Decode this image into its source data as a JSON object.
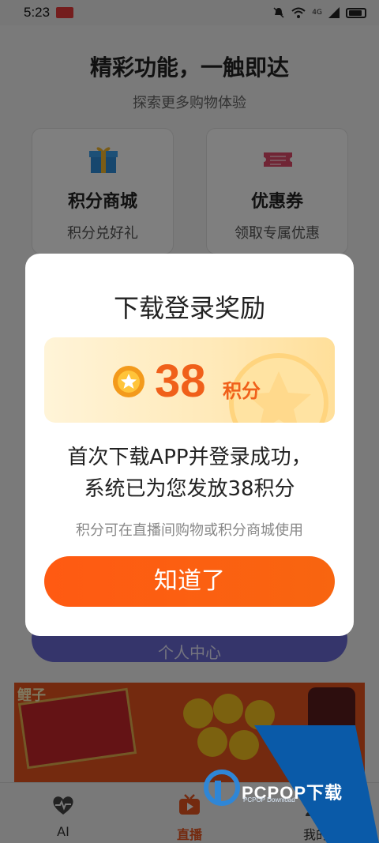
{
  "status_bar": {
    "time": "5:23",
    "signal_text": "4G"
  },
  "page": {
    "feature_title": "精彩功能，一触即达",
    "feature_subtitle": "探索更多购物体验",
    "cards": [
      {
        "title": "积分商城",
        "desc": "积分兑好礼",
        "icon": "gift-icon"
      },
      {
        "title": "优惠券",
        "desc": "领取专属优惠",
        "icon": "coupon-icon"
      }
    ],
    "profile_button": "个人中心",
    "banner_text": "鲤子"
  },
  "dialog": {
    "title": "下载登录奖励",
    "points": "38",
    "points_unit": "积分",
    "message_line1": "首次下载APP并登录成功，",
    "message_line2": "系统已为您发放38积分",
    "note": "积分可在直播间购物或积分商城使用",
    "confirm": "知道了"
  },
  "tabbar": {
    "items": [
      {
        "label": "AI",
        "icon": "heart-pulse-icon"
      },
      {
        "label": "直播",
        "icon": "tv-play-icon",
        "active": true
      },
      {
        "label": "我的",
        "icon": "person-icon"
      }
    ]
  },
  "watermark": {
    "text": "PCPOP下载",
    "sub": "PCPOP Download"
  },
  "colors": {
    "accent": "#f0601a",
    "button": "#ff5a12",
    "overlay": "rgba(0,0,0,0.5)"
  }
}
